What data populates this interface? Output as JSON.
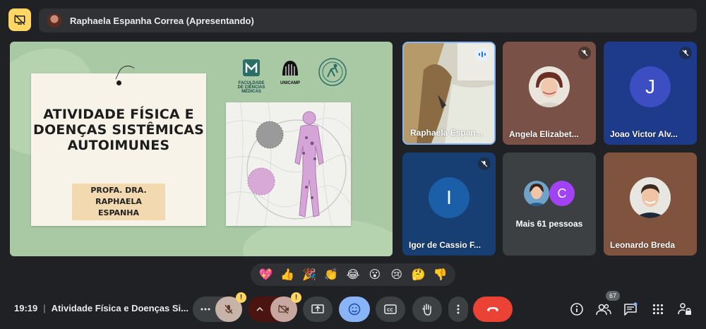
{
  "presenter": {
    "name_label": "Raphaela Espanha Correa (Apresentando)"
  },
  "slide": {
    "title": "ATIVIDADE FÍSICA E DOENÇAS SISTÊMICAS AUTOIMUNES",
    "author": "PROFA. DRA. RAPHAELA ESPANHA",
    "logos": [
      {
        "name": "FACULDADE DE CIÊNCIAS MÉDICAS"
      },
      {
        "name": "UNICAMP"
      }
    ]
  },
  "participants": [
    {
      "name": "Raphaela Espan...",
      "state": "speaking"
    },
    {
      "name": "Angela Elizabet...",
      "state": "muted"
    },
    {
      "name": "Joao Victor Alv...",
      "state": "muted",
      "initial": "J",
      "color": "#3c4ec2"
    },
    {
      "name": "Igor de Cassio F...",
      "state": "muted",
      "initial": "I",
      "color": "#1a5fa8"
    },
    {
      "name": "Mais 61 pessoas",
      "initial": "C",
      "color": "#a142f4"
    },
    {
      "name": "Leonardo Breda"
    }
  ],
  "reactions": [
    "💖",
    "👍",
    "🎉",
    "👏",
    "😂",
    "😮",
    "😢",
    "🤔",
    "👎"
  ],
  "bottom": {
    "time": "19:19",
    "meeting_title": "Atividade Física e Doenças Si...",
    "people_count": "67"
  },
  "colors": {
    "accent_yellow": "#fdd663",
    "hangup_red": "#ea4335",
    "active_blue": "#8ab4f8"
  }
}
